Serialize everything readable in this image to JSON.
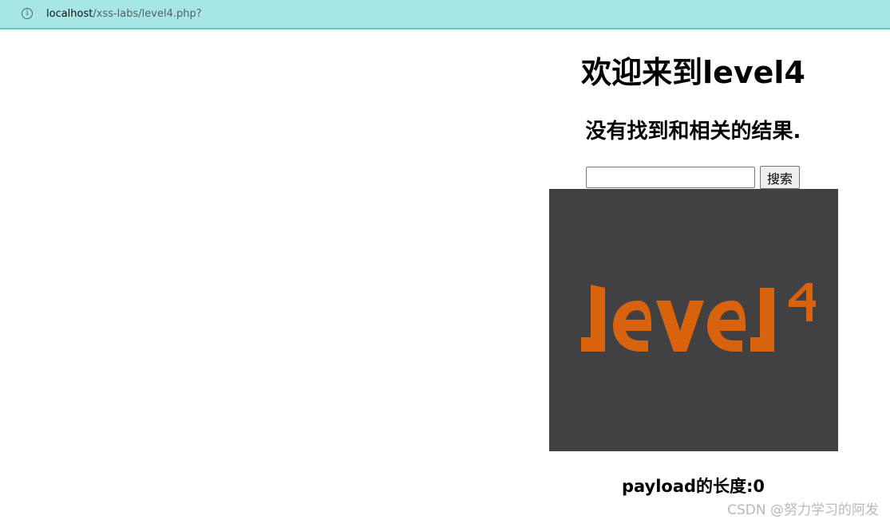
{
  "browser": {
    "info_icon": "info-icon",
    "url_host": "localhost",
    "url_path": "/xss-labs/level4.php?"
  },
  "page": {
    "title": "欢迎来到level4",
    "result_text": "没有找到和相关的结果.",
    "search": {
      "value": "",
      "placeholder": "",
      "button_label": "搜索"
    },
    "image_logo_text": "level4",
    "payload_length": "payload的长度:0"
  },
  "watermark": "CSDN @努力学习的阿发",
  "colors": {
    "browser_bar": "#a8e6e6",
    "image_bg": "#414143",
    "logo_orange": "#d9620d",
    "watermark": "#b8b8b8"
  }
}
